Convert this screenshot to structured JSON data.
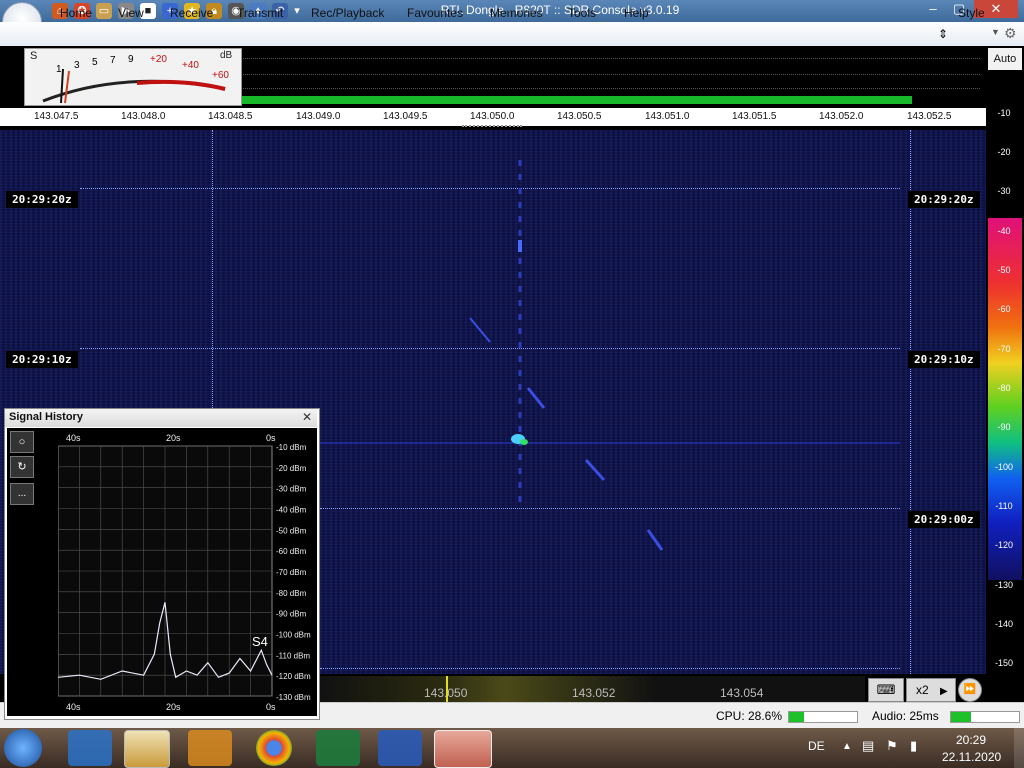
{
  "window": {
    "title": "RTL Dongle - R820T :: SDR Console v3.0.19",
    "controls": [
      "–",
      "▢",
      "✕"
    ]
  },
  "ribbon": {
    "tabs": [
      "Home",
      "View",
      "Receive",
      "Transmit",
      "Rec/Playback",
      "Favourites",
      "Memories",
      "Tools",
      "Help"
    ],
    "style_label": "Style"
  },
  "smeter": {
    "s_label": "S",
    "db_label": "dB",
    "scale": [
      "1",
      "3",
      "5",
      "7",
      "9",
      "+20",
      "+40",
      "+60"
    ]
  },
  "freq_axis": [
    "143.047.5",
    "143.048.0",
    "143.048.5",
    "143.049.0",
    "143.049.5",
    "143.050.0",
    "143.050.5",
    "143.051.0",
    "143.051.5",
    "143.052.0",
    "143.052.5"
  ],
  "right_scale": {
    "auto_label": "Auto",
    "ticks": [
      "-10",
      "-20",
      "-30",
      "-40",
      "-50",
      "-60",
      "-70",
      "-80",
      "-90",
      "-100",
      "-110",
      "-120",
      "-130",
      "-140",
      "-150"
    ]
  },
  "waterfall": {
    "time_labels": [
      "20:29:20z",
      "20:29:10z",
      "20:29:00z"
    ]
  },
  "bottom_ruler": {
    "ticks": [
      "143.050",
      "143.052",
      "143.054"
    ],
    "zoom_label": "x2"
  },
  "status": {
    "cpu": "CPU: 28.6%",
    "audio": "Audio: 25ms"
  },
  "signal_history": {
    "title": "Signal History",
    "close": "✕",
    "top_time_labels": [
      "40s",
      "20s",
      "0s"
    ],
    "bottom_time_labels": [
      "40s",
      "20s",
      "0s"
    ],
    "y_labels": [
      "-10 dBm",
      "-20 dBm",
      "-30 dBm",
      "-40 dBm",
      "-50 dBm",
      "-60 dBm",
      "-70 dBm",
      "-80 dBm",
      "-90 dBm",
      "-100 dBm",
      "-110 dBm",
      "-120 dBm",
      "-130 dBm"
    ],
    "s_reading": "S4",
    "more": "...",
    "chart_data": {
      "type": "line",
      "xlabel": "",
      "ylabel": "",
      "ylim": [
        -130,
        -10
      ],
      "x": [
        40,
        36,
        32,
        28,
        24,
        22,
        21,
        20,
        19,
        18,
        16,
        14,
        12,
        10,
        8,
        6,
        4,
        2,
        1,
        0
      ],
      "values": [
        -121,
        -120,
        -122,
        -118,
        -120,
        -110,
        -95,
        -85,
        -110,
        -121,
        -118,
        -120,
        -114,
        -121,
        -119,
        -112,
        -118,
        -108,
        -115,
        -120
      ]
    }
  },
  "taskbar": {
    "lang": "DE",
    "time": "20:29",
    "date": "22.11.2020"
  }
}
